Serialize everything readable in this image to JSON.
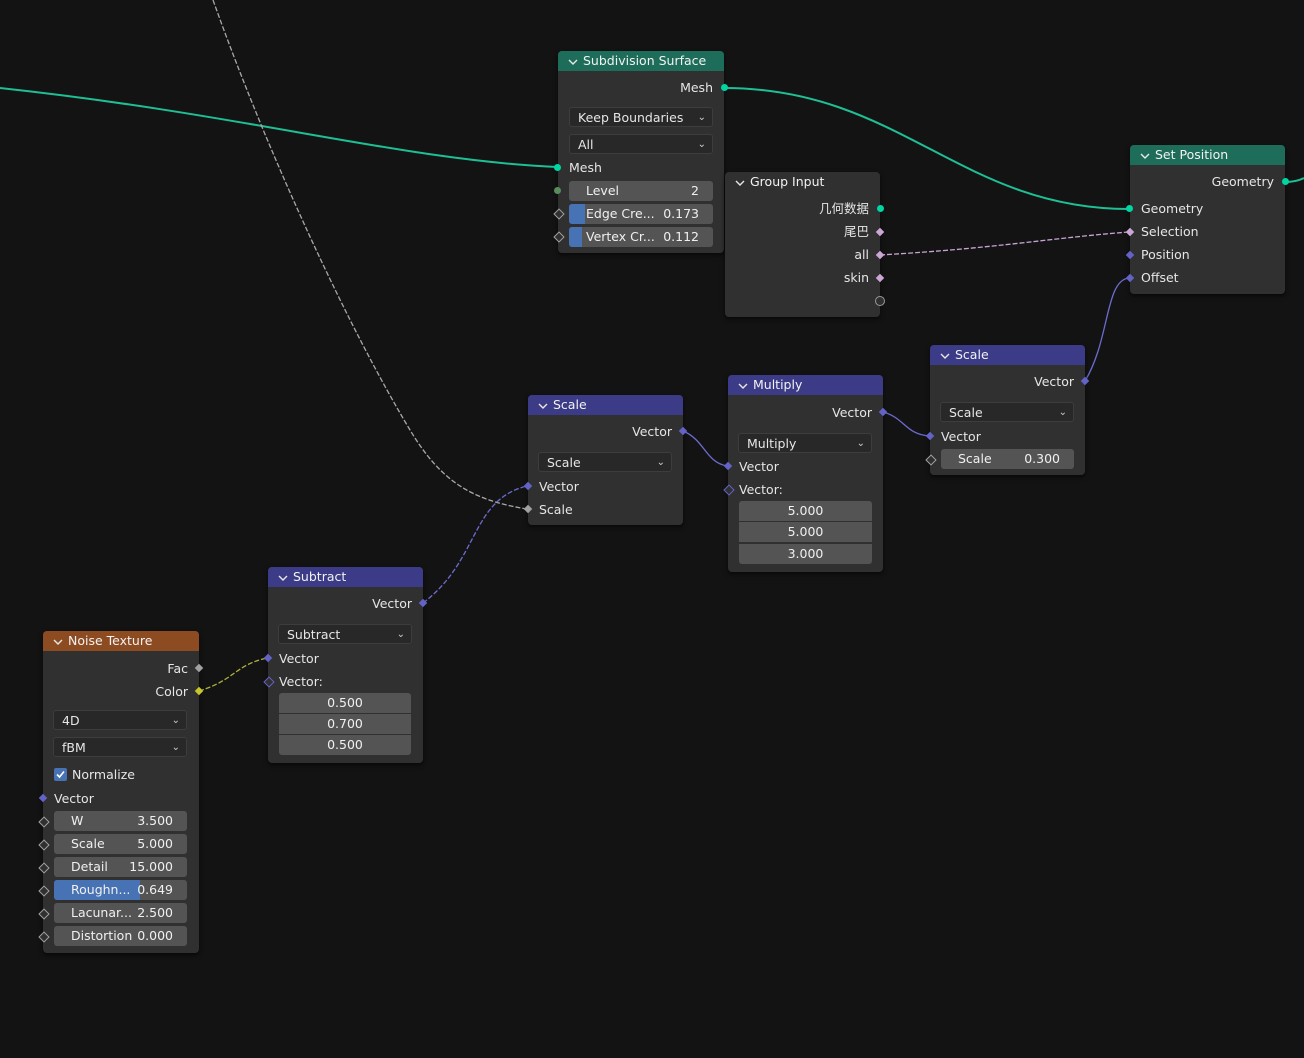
{
  "colors": {
    "geometry_socket": "#00d6a3",
    "vector_socket": "#6363c7",
    "float_socket": "#a1a1a1",
    "color_socket": "#c7c729",
    "bool_socket": "#cca6d6",
    "int_socket": "#598c5c",
    "header_geometry": "#1e6d5b",
    "header_vector": "#3b3b87",
    "header_texture": "#8d4b22"
  },
  "subdivision": {
    "title": "Subdivision Surface",
    "out_mesh": "Mesh",
    "boundary_mode": "Keep Boundaries",
    "uv_mode": "All",
    "in_mesh": "Mesh",
    "level_label": "Level",
    "level_value": "2",
    "edge_label": "Edge Cre...",
    "edge_value": "0.173",
    "edge_fraction": 0.173,
    "vertex_label": "Vertex Cr...",
    "vertex_value": "0.112",
    "vertex_fraction": 0.112
  },
  "group_input": {
    "title": "Group Input",
    "out_geometry": "几何数据",
    "out_tail": "尾巴",
    "out_all": "all",
    "out_skin": "skin"
  },
  "set_position": {
    "title": "Set Position",
    "out_geometry": "Geometry",
    "in_geometry": "Geometry",
    "in_selection": "Selection",
    "in_position": "Position",
    "in_offset": "Offset"
  },
  "scale_right": {
    "title": "Scale",
    "out_vector": "Vector",
    "operation": "Scale",
    "in_vector": "Vector",
    "scale_label": "Scale",
    "scale_value": "0.300"
  },
  "multiply": {
    "title": "Multiply",
    "out_vector": "Vector",
    "operation": "Multiply",
    "in_vector": "Vector",
    "in_vector2": "Vector:",
    "values": [
      "5.000",
      "5.000",
      "3.000"
    ]
  },
  "scale_mid": {
    "title": "Scale",
    "out_vector": "Vector",
    "operation": "Scale",
    "in_vector": "Vector",
    "in_scale": "Scale"
  },
  "subtract": {
    "title": "Subtract",
    "out_vector": "Vector",
    "operation": "Subtract",
    "in_vector": "Vector",
    "in_vector2": "Vector:",
    "values": [
      "0.500",
      "0.700",
      "0.500"
    ]
  },
  "noise": {
    "title": "Noise Texture",
    "out_fac": "Fac",
    "out_color": "Color",
    "dimensions": "4D",
    "noise_type": "fBM",
    "normalize_label": "Normalize",
    "normalize_checked": true,
    "in_vector": "Vector",
    "w_label": "W",
    "w_value": "3.500",
    "scale_label": "Scale",
    "scale_value": "5.000",
    "detail_label": "Detail",
    "detail_value": "15.000",
    "roughness_label": "Roughn...",
    "roughness_value": "0.649",
    "roughness_fraction": 0.649,
    "lacunarity_label": "Lacunar...",
    "lacunarity_value": "2.500",
    "distortion_label": "Distortion",
    "distortion_value": "0.000"
  }
}
